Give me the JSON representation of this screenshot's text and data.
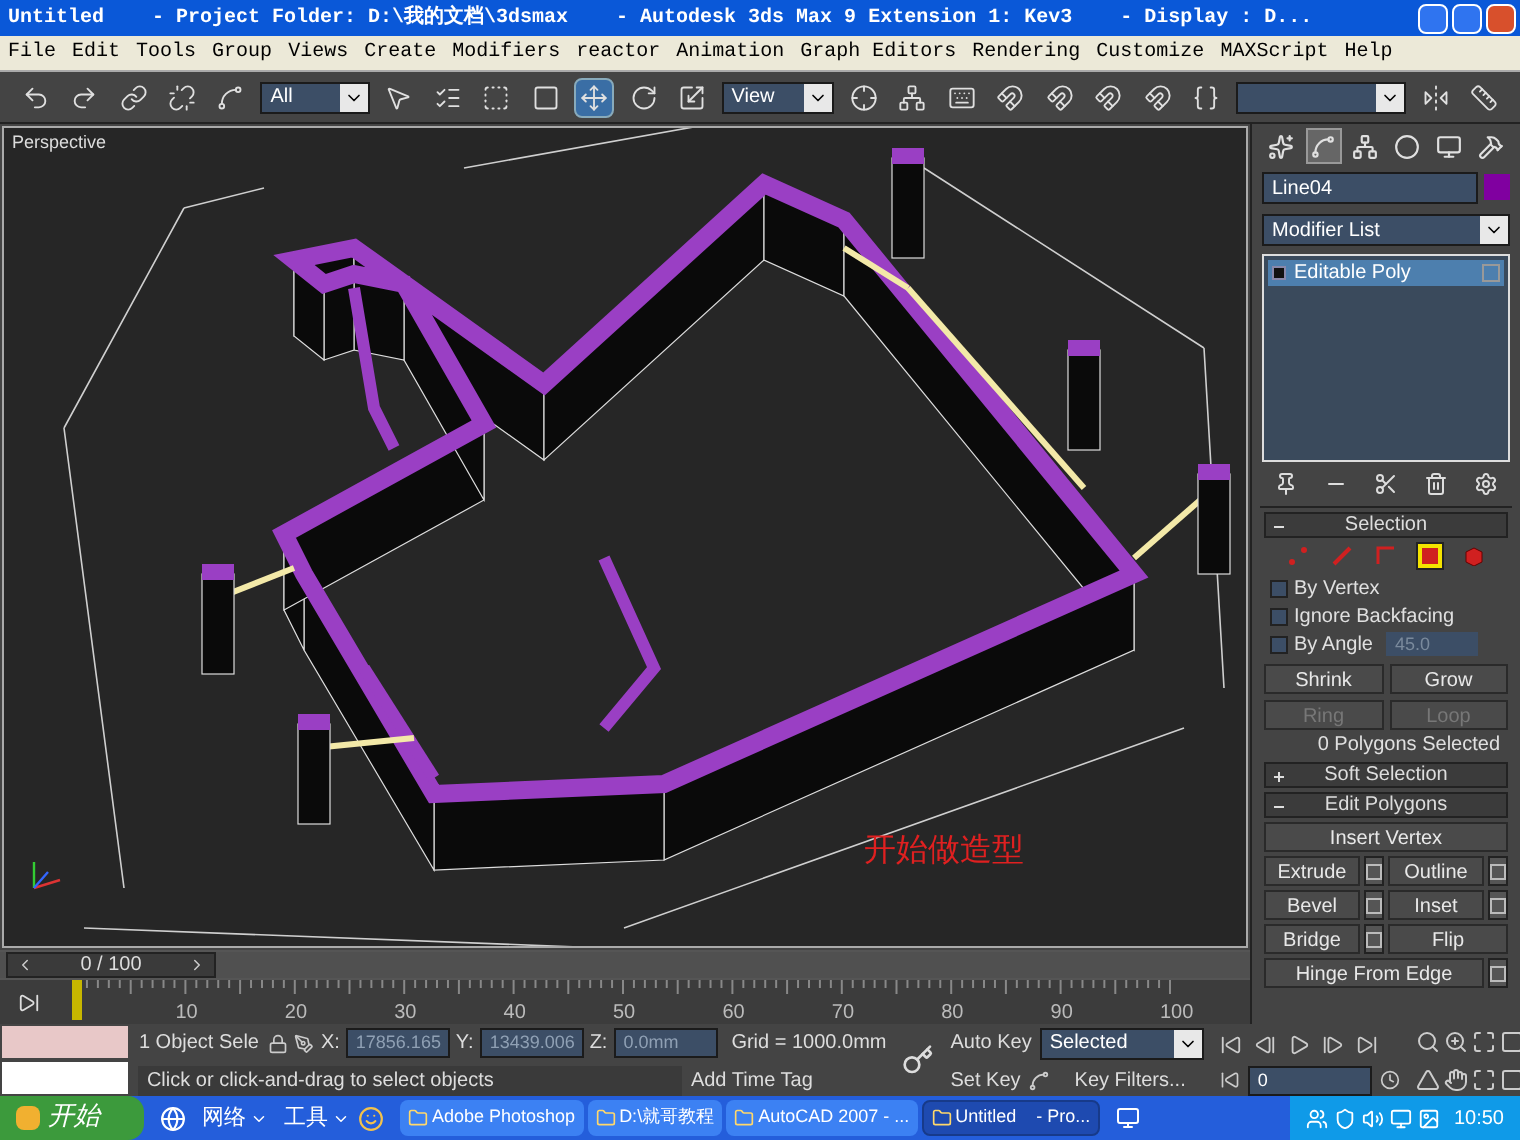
{
  "window": {
    "title": "Untitled    - Project Folder: D:\\我的文档\\3dsmax    - Autodesk 3ds Max 9 Extension 1: Kev3    - Display : D..."
  },
  "menu": [
    "File",
    "Edit",
    "Tools",
    "Group",
    "Views",
    "Create",
    "Modifiers",
    "reactor",
    "Animation",
    "Graph Editors",
    "Rendering",
    "Customize",
    "MAXScript",
    "Help"
  ],
  "toolbar": {
    "selection_filter": "All",
    "reference_coordinate": "View",
    "tools": [
      {
        "kind": "undo",
        "selected": false
      },
      {
        "kind": "redo",
        "selected": false
      },
      {
        "kind": "link",
        "selected": false
      },
      {
        "kind": "unlink",
        "selected": false
      },
      {
        "kind": "bind",
        "selected": false
      },
      {
        "kind": "filter"
      },
      {
        "kind": "select",
        "selected": false
      },
      {
        "kind": "select-by-name",
        "selected": false
      },
      {
        "kind": "region",
        "selected": false
      },
      {
        "kind": "crossing",
        "selected": false
      },
      {
        "kind": "move",
        "selected": true
      },
      {
        "kind": "rotate",
        "selected": false
      },
      {
        "kind": "scale",
        "selected": false
      },
      {
        "kind": "coordinate"
      },
      {
        "kind": "pivot",
        "selected": false
      },
      {
        "kind": "manipulate",
        "selected": false
      },
      {
        "kind": "keyboard",
        "selected": false
      },
      {
        "kind": "snap",
        "selected": false
      },
      {
        "kind": "snap",
        "selected": false
      },
      {
        "kind": "snap",
        "selected": false
      },
      {
        "kind": "snap",
        "selected": false
      },
      {
        "kind": "named-selection",
        "selected": false
      },
      {
        "kind": "named-field"
      },
      {
        "kind": "mirror",
        "selected": false
      },
      {
        "kind": "align",
        "selected": false
      }
    ]
  },
  "viewport": {
    "label": "Perspective",
    "caption": "开始做造型"
  },
  "command_panel": {
    "tabs": [
      {
        "kind": "create",
        "selected": false
      },
      {
        "kind": "modify",
        "selected": true
      },
      {
        "kind": "hierarchy",
        "selected": false
      },
      {
        "kind": "motion",
        "selected": false
      },
      {
        "kind": "display",
        "selected": false
      },
      {
        "kind": "utilities",
        "selected": false
      }
    ],
    "object_name": "Line04",
    "modifier_list": "Modifier List",
    "stack": [
      {
        "label": "Editable Poly",
        "selected": true
      }
    ],
    "selection": {
      "title": "Selection",
      "expanded": true,
      "levels": [
        {
          "kind": "vertex",
          "selected": false
        },
        {
          "kind": "edge",
          "selected": false
        },
        {
          "kind": "border",
          "selected": false
        },
        {
          "kind": "polygon",
          "selected": true
        },
        {
          "kind": "element",
          "selected": false
        }
      ],
      "checkboxes": [
        {
          "label": "By Vertex",
          "checked": false
        },
        {
          "label": "Ignore Backfacing",
          "checked": false
        },
        {
          "label": "By Angle",
          "checked": false
        }
      ],
      "angle": "45.0",
      "buttons": [
        {
          "label": "Shrink",
          "disabled": false
        },
        {
          "label": "Grow",
          "disabled": false
        },
        {
          "label": "Ring",
          "disabled": true
        },
        {
          "label": "Loop",
          "disabled": true
        }
      ],
      "status": "0 Polygons Selected"
    },
    "soft_selection": {
      "title": "Soft Selection",
      "expanded": false
    },
    "edit_polygons": {
      "title": "Edit Polygons",
      "expanded": true,
      "buttons": [
        {
          "label": "Insert Vertex",
          "settings": false
        },
        {
          "label": "Extrude",
          "settings": true
        },
        {
          "label": "Outline",
          "settings": true
        },
        {
          "label": "Bevel",
          "settings": true
        },
        {
          "label": "Inset",
          "settings": true
        },
        {
          "label": "Bridge",
          "settings": true
        },
        {
          "label": "Flip",
          "settings": false
        },
        {
          "label": "Hinge From Edge",
          "settings": true
        }
      ]
    }
  },
  "time_slider": {
    "label": "0 / 100",
    "level": 0
  },
  "trackbar_ticks": [
    "10",
    "20",
    "30",
    "40",
    "50",
    "60",
    "70",
    "80",
    "90",
    "100"
  ],
  "status_bar": {
    "selection_count": "1 Object Sele",
    "coordinates": [
      {
        "label": "X:",
        "value": "17856.165"
      },
      {
        "label": "Y:",
        "value": "13439.006"
      },
      {
        "label": "Z:",
        "value": "0.0mm"
      }
    ],
    "grid": "Grid = 1000.0mm",
    "prompt": "Click or click-and-drag to select objects",
    "add_time_tag": "Add Time Tag",
    "auto_key": "Auto Key",
    "key_mode": "Selected",
    "set_key": "Set Key",
    "key_filters": "Key Filters...",
    "frame": "0"
  },
  "taskbar": {
    "start": "开始",
    "quick_launch": [
      "网络",
      "工具"
    ],
    "tasks": [
      {
        "label": "Adobe Photoshop",
        "selected": false
      },
      {
        "label": "D:\\就哥教程",
        "selected": false
      },
      {
        "label": "AutoCAD 2007 - ...",
        "selected": false
      },
      {
        "label": "Untitled    - Pro...",
        "selected": true
      }
    ],
    "clock": "10:50"
  }
}
